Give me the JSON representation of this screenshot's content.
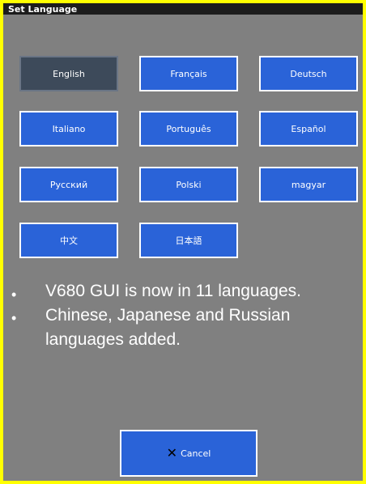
{
  "window": {
    "title": "Set Language"
  },
  "languages": [
    {
      "label": "English",
      "selected": true
    },
    {
      "label": "Français",
      "selected": false
    },
    {
      "label": "Deutsch",
      "selected": false
    },
    {
      "label": "Italiano",
      "selected": false
    },
    {
      "label": "Português",
      "selected": false
    },
    {
      "label": "Español",
      "selected": false
    },
    {
      "label": "Русский",
      "selected": false
    },
    {
      "label": "Polski",
      "selected": false
    },
    {
      "label": "magyar",
      "selected": false
    },
    {
      "label": "中文",
      "selected": false
    },
    {
      "label": "日本語",
      "selected": false
    }
  ],
  "notes": {
    "bullet": "•",
    "line1": "V680 GUI is now in 11 languages.",
    "line2": "Chinese, Japanese and Russian",
    "line3": "languages added."
  },
  "footer": {
    "cancel_label": "Cancel",
    "cancel_icon": "close-icon"
  },
  "colors": {
    "border": "#ffff00",
    "background": "#808080",
    "button": "#2a63d8",
    "selected_button": "#3d4a5a"
  }
}
